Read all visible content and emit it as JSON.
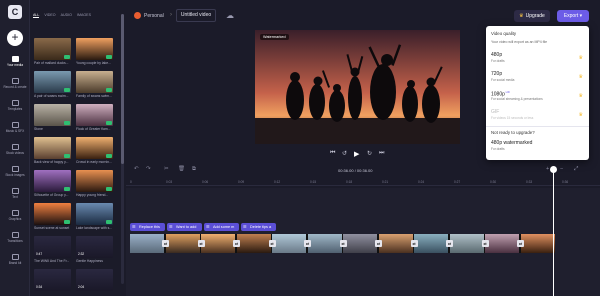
{
  "app": {
    "logo_text": "C"
  },
  "rail": {
    "items": [
      {
        "label": "Your media",
        "icon": "folder-icon",
        "active": true
      },
      {
        "label": "Record & create",
        "icon": "record-icon"
      },
      {
        "label": "Templates",
        "icon": "templates-icon"
      },
      {
        "label": "Music & SFX",
        "icon": "music-icon"
      },
      {
        "label": "Stock videos",
        "icon": "video-icon"
      },
      {
        "label": "Stock images",
        "icon": "image-icon"
      },
      {
        "label": "Text",
        "icon": "text-icon"
      },
      {
        "label": "Graphics",
        "icon": "graphics-icon"
      },
      {
        "label": "Transitions",
        "icon": "transitions-icon"
      },
      {
        "label": "Brand kit",
        "icon": "brand-icon"
      }
    ]
  },
  "media": {
    "tabs": [
      "ALL",
      "VIDEO",
      "AUDIO",
      "IMAGES"
    ],
    "active_tab": "ALL",
    "items": [
      {
        "caption": "Pair of mallard ducks...",
        "added": true
      },
      {
        "caption": "Young couple by lake...",
        "added": true
      },
      {
        "caption": "A pair of swans swim...",
        "added": true
      },
      {
        "caption": "Family of swans swim...",
        "added": true
      },
      {
        "caption": "Stone",
        "added": true
      },
      {
        "caption": "Flock of Greater flam...",
        "added": true
      },
      {
        "caption": "Back view of happy y...",
        "added": true
      },
      {
        "caption": "Crowd in early mornin...",
        "added": true
      },
      {
        "caption": "Silhouette of Group y...",
        "added": true
      },
      {
        "caption": "Happy young friend...",
        "added": true
      },
      {
        "caption": "Sunset scene at sunset",
        "added": true
      },
      {
        "caption": "Lake landscape with s...",
        "added": true
      },
      {
        "caption": "The WWII And The Fr...",
        "duration": "0:47"
      },
      {
        "caption": "Gentle Happiness",
        "duration": "2:32"
      },
      {
        "caption": "",
        "duration": "0:34"
      },
      {
        "caption": "",
        "duration": "2:04"
      }
    ]
  },
  "header": {
    "workspace": "Personal",
    "project_title": "Untitled video",
    "upgrade_label": "Upgrade",
    "export_label": "Export"
  },
  "preview": {
    "watermark": "Watermarked"
  },
  "export_menu": {
    "heading": "Video quality",
    "subheading": "Your video will export as an MP4 file",
    "options": [
      {
        "name": "480p",
        "desc": "For drafts",
        "badge": "",
        "premium": true,
        "enabled": true
      },
      {
        "name": "720p",
        "desc": "For social media",
        "badge": "",
        "premium": true,
        "enabled": true
      },
      {
        "name": "1080p",
        "desc": "For social streaming & presentations",
        "badge": "HD",
        "premium": true,
        "enabled": true
      },
      {
        "name": "GIF",
        "desc": "For videos 15 seconds or less",
        "badge": "",
        "premium": true,
        "enabled": false
      }
    ],
    "upsell_heading": "Not ready to upgrade?",
    "watermark_option": {
      "name": "480p watermarked",
      "desc": "For drafts"
    }
  },
  "timeline": {
    "current_time": "00:36.00",
    "total_time": "00:36.00",
    "ruler_ticks": [
      "0",
      "0:03",
      "0:06",
      "0:09",
      "0:12",
      "0:15",
      "0:18",
      "0:21",
      "0:24",
      "0:27",
      "0:30",
      "0:33",
      "0:36"
    ],
    "clip_actions": [
      "Replace this",
      "Want to add",
      "Add some m",
      "Delete tips a"
    ],
    "clip_count": 12
  },
  "colors": {
    "accent": "#6c5ce7",
    "premium": "#f5c244",
    "added": "#2fbf71"
  }
}
